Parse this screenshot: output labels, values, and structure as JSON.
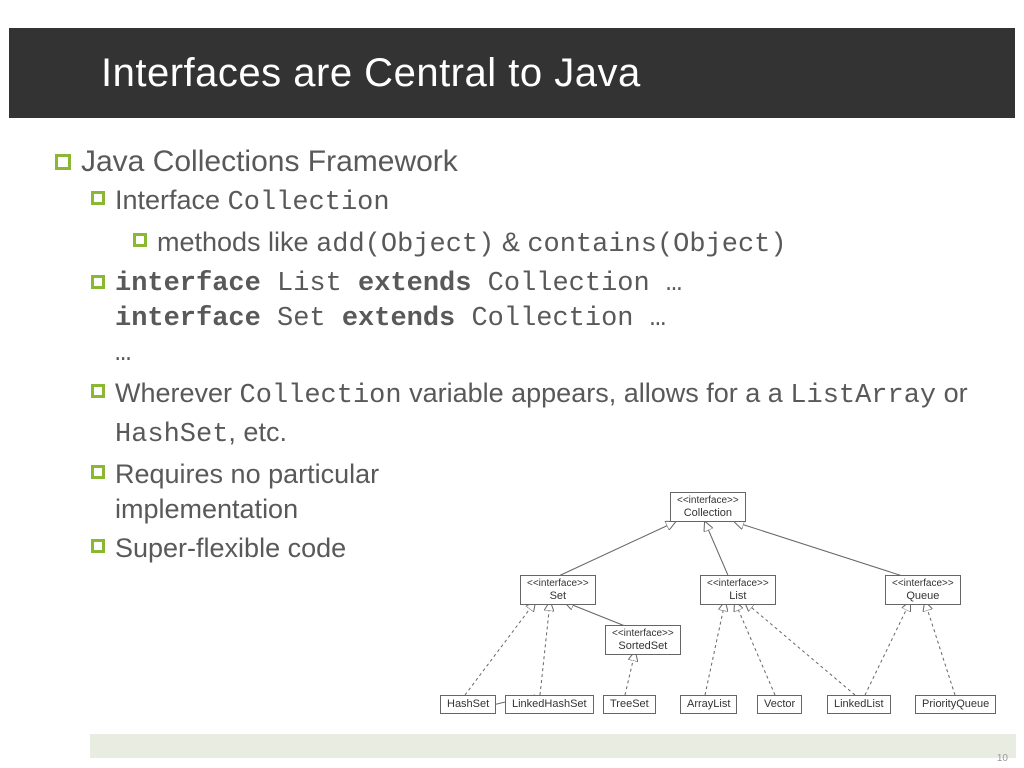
{
  "slide": {
    "title": "Interfaces are Central to Java",
    "page_number": "10"
  },
  "bullets": {
    "l1": "Java Collections Framework",
    "l2a_pre": "Interface ",
    "l2a_code": "Collection",
    "l3_pre": "methods like ",
    "l3_code1": "add(Object)",
    "l3_amp": " & ",
    "l3_code2": "contains(Object)",
    "l2b_kw1": "interface",
    "l2b_name1": " List ",
    "l2b_kw2": "extends",
    "l2b_rest1": " Collection …",
    "l2b_kw3": "interface",
    "l2b_name2": " Set  ",
    "l2b_kw4": "extends",
    "l2b_rest2": " Collection …",
    "l2b_ell": "…",
    "l2c_pre": "Wherever ",
    "l2c_code1": "Collection",
    "l2c_mid": " variable appears, allows for a a ",
    "l2c_code2": "ListArray",
    "l2c_or": " or ",
    "l2c_code3": "HashSet",
    "l2c_etc": ", etc.",
    "l2d": "Requires no particular implementation",
    "l2e": "Super-flexible code"
  },
  "diagram": {
    "collection_stereo": "<<interface>>",
    "collection": "Collection",
    "set_stereo": "<<interface>>",
    "set": "Set",
    "list_stereo": "<<interface>>",
    "list": "List",
    "queue_stereo": "<<interface>>",
    "queue": "Queue",
    "sortedset_stereo": "<<interface>>",
    "sortedset": "SortedSet",
    "hashset": "HashSet",
    "linkedhashset": "LinkedHashSet",
    "treeset": "TreeSet",
    "arraylist": "ArrayList",
    "vector": "Vector",
    "linkedlist": "LinkedList",
    "priorityqueue": "PriorityQueue"
  }
}
